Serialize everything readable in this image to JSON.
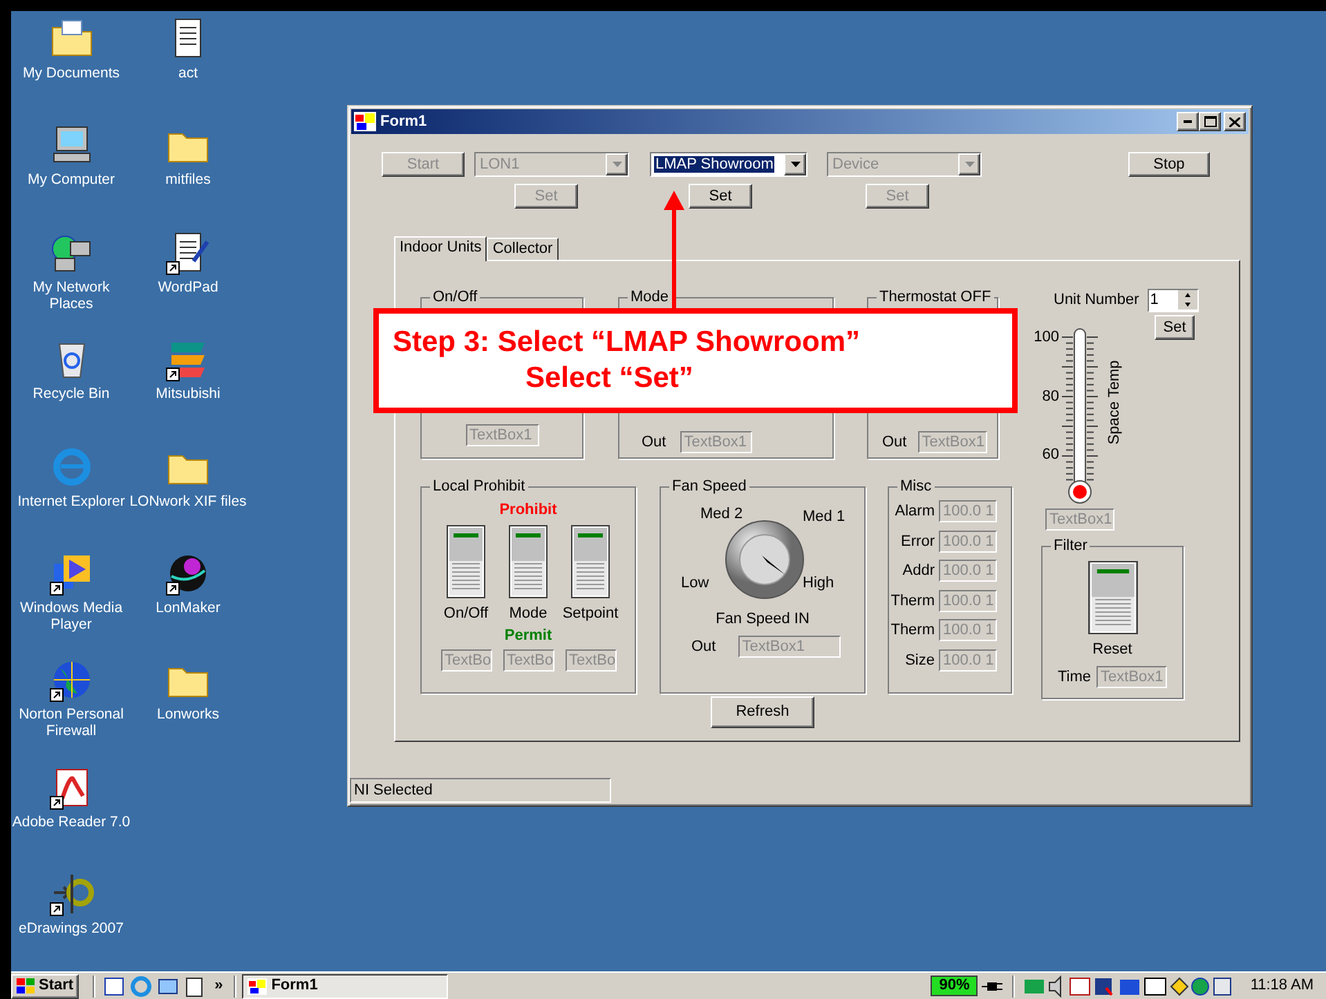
{
  "desktop": {
    "icon_rows": [
      [
        {
          "label": "My Documents",
          "kind": "docs-folder",
          "shortcut": false
        },
        {
          "label": "act",
          "kind": "document",
          "shortcut": false
        }
      ],
      [
        {
          "label": "My Computer",
          "kind": "computer",
          "shortcut": false
        },
        {
          "label": "mitfiles",
          "kind": "folder",
          "shortcut": false
        }
      ],
      [
        {
          "label": "My Network\nPlaces",
          "kind": "network",
          "shortcut": false
        },
        {
          "label": "WordPad",
          "kind": "notepad",
          "shortcut": true
        }
      ],
      [
        {
          "label": "Recycle Bin",
          "kind": "recycle",
          "shortcut": false
        },
        {
          "label": "Mitsubishi",
          "kind": "stripes",
          "shortcut": true
        }
      ],
      [
        {
          "label": "Internet Explorer",
          "kind": "browser",
          "shortcut": false
        },
        {
          "label": "LONwork XIF files",
          "kind": "folder",
          "shortcut": false
        }
      ],
      [
        {
          "label": "Windows Media\nPlayer",
          "kind": "media",
          "shortcut": true
        },
        {
          "label": "LonMaker",
          "kind": "sphere",
          "shortcut": true
        }
      ],
      [
        {
          "label": "Norton Personal\nFirewall",
          "kind": "globe",
          "shortcut": true
        },
        {
          "label": "Lonworks",
          "kind": "folder",
          "shortcut": false
        }
      ],
      [
        {
          "label": "Adobe Reader 7.0",
          "kind": "pdf",
          "shortcut": true
        }
      ],
      [
        {
          "label": "eDrawings 2007",
          "kind": "edrawings",
          "shortcut": true
        }
      ]
    ]
  },
  "window": {
    "title": "Form1",
    "toolbar": {
      "start": {
        "label": "Start",
        "disabled": true
      },
      "selectors": [
        {
          "value": "LON1",
          "disabled": true,
          "highlighted": false,
          "set": {
            "label": "Set",
            "disabled": true
          }
        },
        {
          "value": "LMAP Showroom",
          "disabled": false,
          "highlighted": true,
          "set": {
            "label": "Set",
            "disabled": false
          }
        },
        {
          "value": "Device",
          "disabled": true,
          "highlighted": false,
          "set": {
            "label": "Set",
            "disabled": true
          }
        }
      ],
      "stop": {
        "label": "Stop",
        "disabled": false
      }
    },
    "tabs": [
      {
        "label": "Indoor Units",
        "selected": true
      },
      {
        "label": "Collector",
        "selected": false
      }
    ],
    "on_off": {
      "title": "On/Off",
      "field": {
        "value": "TextBox1",
        "disabled": true
      }
    },
    "mode": {
      "title": "Mode",
      "out_label": "Out",
      "field": {
        "value": "TextBox1",
        "disabled": true
      }
    },
    "thermostat": {
      "title": "Thermostat OFF",
      "out_label": "Out",
      "field": {
        "value": "TextBox1",
        "disabled": true
      }
    },
    "unit_number": {
      "label": "Unit Number",
      "value": "1",
      "set": "Set"
    },
    "thermometer": {
      "ticks": [
        "100",
        "80",
        "60"
      ],
      "label": "Space Temp",
      "field": {
        "value": "TextBox1",
        "disabled": true
      }
    },
    "local_prohibit": {
      "title": "Local Prohibit",
      "top_label": "Prohibit",
      "bottom_label": "Permit",
      "switches": [
        {
          "label": "On/Off",
          "on": true,
          "field": {
            "value": "TextBo",
            "disabled": true
          }
        },
        {
          "label": "Mode",
          "on": true,
          "field": {
            "value": "TextBo",
            "disabled": true
          }
        },
        {
          "label": "Setpoint",
          "on": true,
          "field": {
            "value": "TextBo",
            "disabled": true
          }
        }
      ]
    },
    "fan_speed": {
      "title": "Fan Speed",
      "positions": [
        "Med 2",
        "Med 1",
        "Low",
        "High"
      ],
      "caption": "Fan Speed IN",
      "out_label": "Out",
      "field": {
        "value": "TextBox1",
        "disabled": true
      }
    },
    "misc": {
      "title": "Misc",
      "rows": [
        {
          "label": "Alarm",
          "field": {
            "value": "100.0 1",
            "disabled": true
          }
        },
        {
          "label": "Error",
          "field": {
            "value": "100.0 1",
            "disabled": true
          }
        },
        {
          "label": "Addr",
          "field": {
            "value": "100.0 1",
            "disabled": true
          }
        },
        {
          "label": "Therm",
          "field": {
            "value": "100.0 1",
            "disabled": true
          }
        },
        {
          "label": "Therm",
          "field": {
            "value": "100.0 1",
            "disabled": true
          }
        },
        {
          "label": "Size",
          "field": {
            "value": "100.0 1",
            "disabled": true
          }
        }
      ]
    },
    "filter": {
      "title": "Filter",
      "on": true,
      "switch_label": "Reset",
      "time_label": "Time",
      "field": {
        "value": "TextBox1",
        "disabled": true
      }
    },
    "refresh": "Refresh",
    "status_bar": "NI Selected"
  },
  "callout": {
    "lines": [
      "Step 3: Select “LMAP Showroom”",
      "Select “Set”"
    ]
  },
  "taskbar": {
    "start": "Start",
    "more": "»",
    "tasks": [
      {
        "label": "Form1",
        "selected": true
      }
    ],
    "battery": {
      "reading": "90%"
    },
    "clock": "11:18 AM"
  }
}
